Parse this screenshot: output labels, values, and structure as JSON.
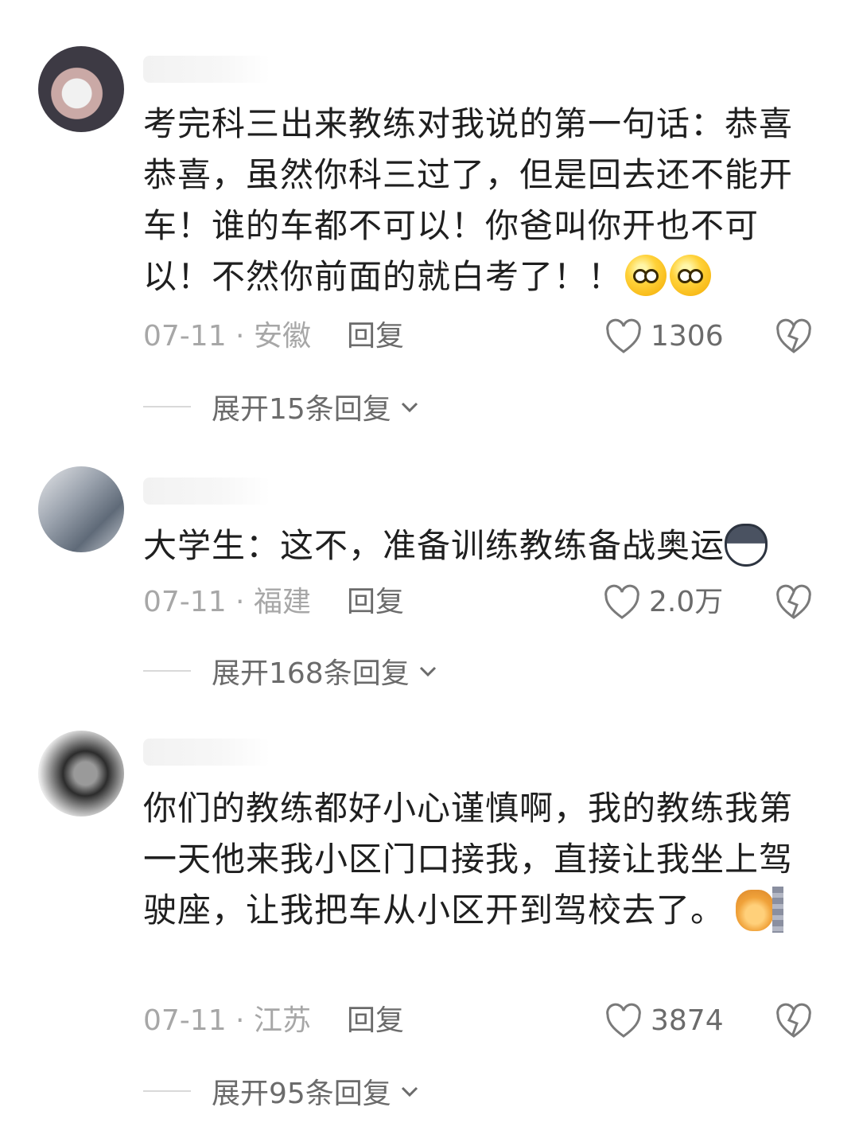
{
  "comments": [
    {
      "text": "考完科三出来教练对我说的第一句话：恭喜恭喜，虽然你科三过了，但是回去还不能开车！谁的车都不可以！你爸叫你开也不可以！不然你前面的就白考了！！",
      "date_location": "07-11 · 安徽",
      "reply_label": "回复",
      "likes": "1306",
      "expand_label": "展开15条回复",
      "emoji": [
        "smiling-face-icon",
        "smiling-face-icon"
      ]
    },
    {
      "text": "大学生：这不，准备训练教练备战奥运",
      "date_location": "07-11 · 福建",
      "reply_label": "回复",
      "likes": "2.0万",
      "expand_label": "展开168条回复",
      "emoji": [
        "dog-face-icon"
      ]
    },
    {
      "text": "你们的教练都好小心谨慎啊，我的教练我第一天他来我小区门口接我，直接让我坐上驾驶座，让我把车从小区开到驾校去了。",
      "date_location": "07-11 · 江苏",
      "reply_label": "回复",
      "likes": "3874",
      "expand_label": "展开95条回复",
      "emoji": [
        "cat-peeking-icon"
      ]
    }
  ]
}
